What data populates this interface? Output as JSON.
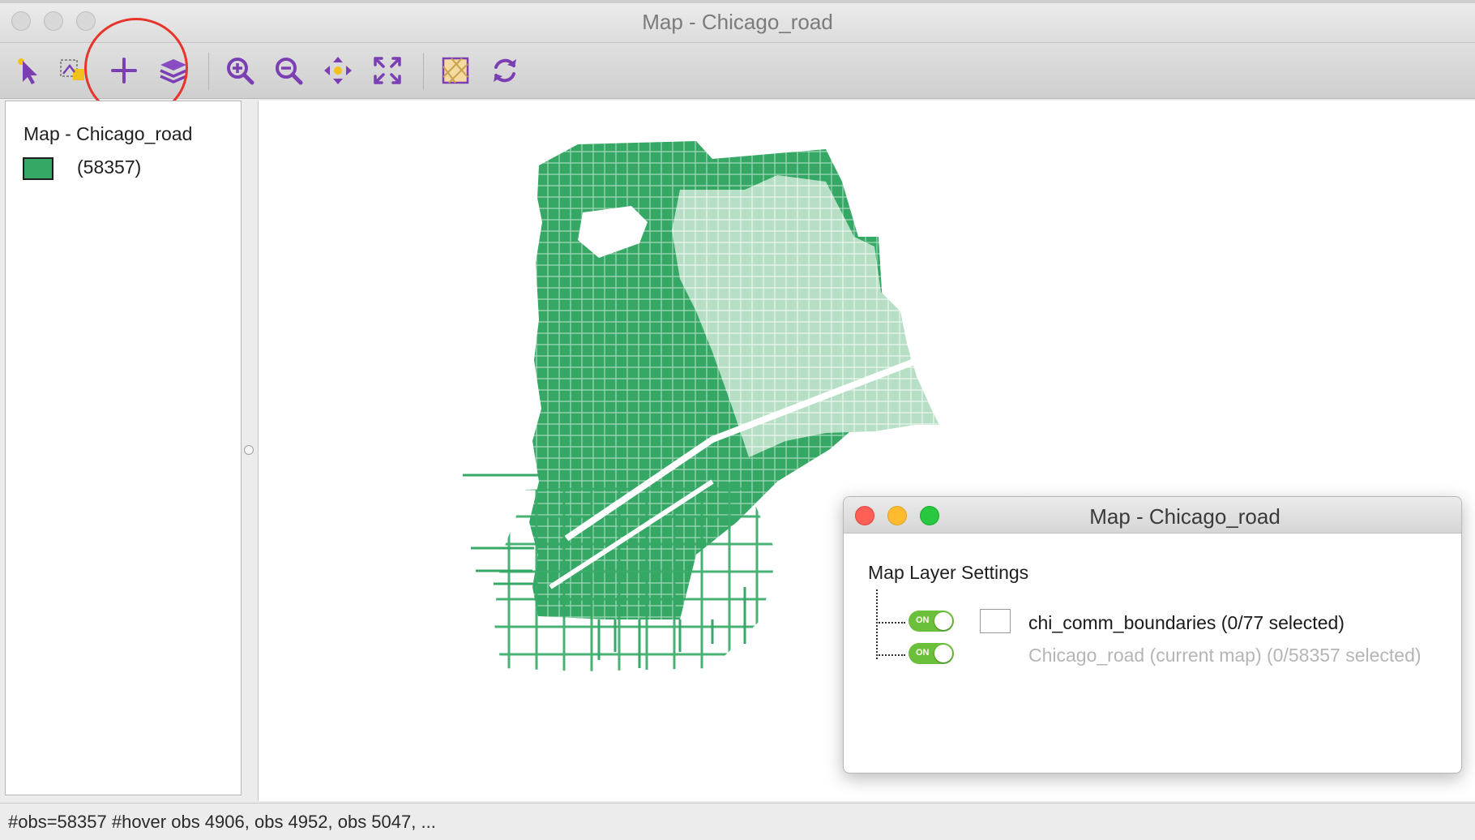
{
  "window": {
    "title": "Map - Chicago_road"
  },
  "toolbar": {
    "tools": [
      {
        "name": "select-tool",
        "icon": "arrow-pointer-icon"
      },
      {
        "name": "selection-shape-tool",
        "icon": "selection-shape-icon"
      },
      {
        "name": "add-layer-tool",
        "icon": "plus-icon"
      },
      {
        "name": "layers-tool",
        "icon": "layers-icon"
      },
      {
        "name": "zoom-in-tool",
        "icon": "zoom-in-icon"
      },
      {
        "name": "zoom-out-tool",
        "icon": "zoom-out-icon"
      },
      {
        "name": "pan-tool",
        "icon": "pan-icon"
      },
      {
        "name": "fit-extent-tool",
        "icon": "fit-extent-icon"
      },
      {
        "name": "basemap-tool",
        "icon": "basemap-icon"
      },
      {
        "name": "refresh-tool",
        "icon": "refresh-icon"
      }
    ],
    "accent_color": "#7b3fb3",
    "highlight_color": "#e8352b"
  },
  "legend": {
    "title": "Map - Chicago_road",
    "count_label": "(58357)",
    "swatch_color": "#34a864"
  },
  "map": {
    "road_color": "#34a864",
    "boundary_color": "#b7dfc5"
  },
  "status": {
    "text": "#obs=58357 #hover obs 4906, obs 4952, obs 5047, ..."
  },
  "dialog": {
    "title": "Map - Chicago_road",
    "heading": "Map Layer Settings",
    "layers": [
      {
        "toggle": "ON",
        "name": "chi_comm_boundaries (0/77 selected)"
      },
      {
        "toggle": "ON",
        "name": "Chicago_road (current map) (0/58357 selected)"
      }
    ]
  }
}
